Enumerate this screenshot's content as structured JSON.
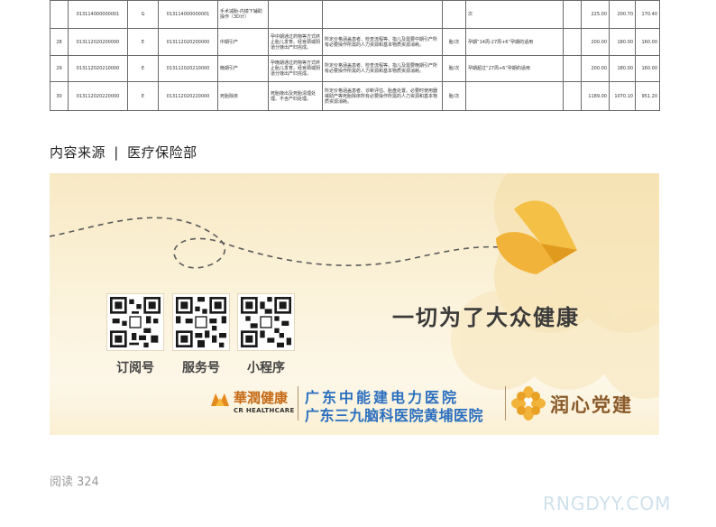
{
  "table": {
    "rows": [
      [
        "",
        "013114000000001",
        "G",
        "013114000000001",
        "手术减胎-内镜下辅助操作（3D计）",
        "",
        "",
        "",
        "次",
        "",
        "225.00",
        "200.70",
        "170.40"
      ],
      [
        "28",
        "013112020200000",
        "E",
        "013112020200000",
        "中期引产",
        "孕中期通过药物等方式终止胎儿发育。经宫颈或阴道分娩出产妇完成。",
        "所定价格涵盖患者、检查流程等。指儿及需要中期引产所有必要操作所需的人力资源和基本物质资源消耗。",
        "胎/次",
        "孕期“14周-27周+6”孕期的适用",
        "",
        "200.00",
        "180.00",
        "160.00"
      ],
      [
        "29",
        "013112020210000",
        "E",
        "013112020210000",
        "晚期引产",
        "孕晚期通过药物等方式终止胎儿发育。经宫颈或阴道分娩出产妇完成。",
        "所定价格涵盖患者、检查流程等。指儿及需要晚期引产所有必要操作所需的人力资源和基本物质资源消耗。",
        "胎/次",
        "孕期超过“27周+6”孕期的适用",
        "",
        "200.00",
        "180.00",
        "160.00"
      ],
      [
        "30",
        "013112020220000",
        "E",
        "013112020220000",
        "死胎除床",
        "死胎娩出及死胎清理处理。不含产妇处理。",
        "所定价格涵盖患者、诊断评估、胎盘处置。必要时使用器械助产等死胎除床所有必要操作所需的人力资源和基本物质资源消耗。",
        "胎/次",
        "",
        "",
        "1189.00",
        "1070.10",
        "951.20"
      ]
    ]
  },
  "source": {
    "label": "内容来源",
    "separator": "|",
    "value": "医疗保险部"
  },
  "banner": {
    "slogan": "一切为了大众健康",
    "qr_labels": [
      "订阅号",
      "服务号",
      "小程序"
    ],
    "brand_cn": "華潤健康",
    "brand_en": "CR HEALTHCARE",
    "hospital_1": "广东中能建电力医院",
    "hospital_2": "广东三九脑科医院黄埔医院",
    "party_brand": "润心党建",
    "colors": {
      "heart": "#f2b33a",
      "hospital_text": "#2a6fc0",
      "brand": "#c56a15"
    }
  },
  "footer": {
    "read_label": "阅读",
    "read_count": "324",
    "watermark": "RNGDYY.COM"
  }
}
